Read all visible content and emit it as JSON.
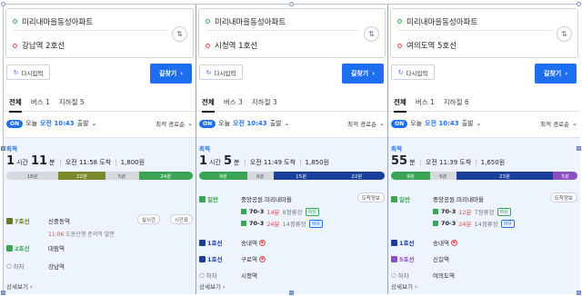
{
  "common": {
    "reset_label": "다시입력",
    "find_label": "길찾기",
    "today_label": "오늘",
    "on_label": "ON",
    "sort_label": "최적 경로순",
    "best_label": "최적",
    "more_label": "상세보기",
    "tab_all": "전체",
    "walk_label": "하차"
  },
  "panels": [
    {
      "start": "미리내마을동성아파트",
      "end": "강남역 2호선",
      "tabs": [
        "전체",
        "버스 1",
        "지하철 5"
      ],
      "depart_time": "오전 10:43",
      "depart_suffix": "출발",
      "duration_h": "1",
      "duration_h_unit": "시간",
      "duration_m": "11",
      "duration_m_unit": "분",
      "arrival": "오전 11:58 도착",
      "fare": "1,800원",
      "bar_segments": [
        {
          "label": "18분",
          "color": "#d6d9de",
          "dark": true
        },
        {
          "label": "22분",
          "color": "#7a8a2b",
          "dark": false
        },
        {
          "label": "5분",
          "color": "#d6d9de",
          "dark": true
        },
        {
          "label": "24분",
          "color": "#3aa655",
          "dark": false
        }
      ],
      "steps": [
        {
          "mode": "7호선",
          "color": "#6b7a1f",
          "place": "신중동역",
          "btn1": "실시간",
          "btn2": "시간표"
        },
        {
          "mode": "2호선",
          "color": "#3aa655",
          "place": "대림역"
        },
        {
          "mode": "하차",
          "color": "",
          "place": "강남역"
        }
      ],
      "sub_time": "11:06",
      "sub_text": "도봉산행",
      "sub_tail": "춘의역 발면"
    },
    {
      "start": "미리내마을동성아파트",
      "end": "시청역 1호선",
      "tabs": [
        "전체",
        "버스 3",
        "지하철 3"
      ],
      "depart_time": "오전 10:43",
      "depart_suffix": "출발",
      "duration_h": "1",
      "duration_h_unit": "시간",
      "duration_m": "5",
      "duration_m_unit": "분",
      "arrival": "오전 11:49 도착",
      "fare": "1,850원",
      "bar_segments": [
        {
          "label": "9분",
          "color": "#3aa655",
          "dark": false
        },
        {
          "label": "6분",
          "color": "#d6d9de",
          "dark": true
        },
        {
          "label": "15분",
          "color": "#1b3f9a",
          "dark": false
        },
        {
          "label": "22분",
          "color": "#1b3f9a",
          "dark": false
        }
      ],
      "stop_btn": "도착정보",
      "steps": [
        {
          "mode": "일반",
          "color": "#3aa655",
          "place": "중앙공원.미리내마을"
        },
        {
          "mode": "1호선",
          "color": "#1b3f9a",
          "place": "송내역"
        },
        {
          "mode": "1호선",
          "color": "#1b3f9a",
          "place": "구로역"
        },
        {
          "mode": "하차",
          "color": "",
          "place": "시청역"
        }
      ],
      "buses": [
        {
          "num": "70-3",
          "min": "14분",
          "info": "8정류장",
          "tag": "여유"
        },
        {
          "num": "70-3",
          "min": "24분",
          "info": "14정류장",
          "tag": "여유"
        }
      ]
    },
    {
      "start": "미리내마을동성아파트",
      "end": "여의도역 5호선",
      "tabs": [
        "전체",
        "버스 1",
        "지하철 6"
      ],
      "depart_time": "오전 10:43",
      "depart_suffix": "출발",
      "duration_h": "",
      "duration_h_unit": "",
      "duration_m": "55",
      "duration_m_unit": "분",
      "arrival": "오전 11:39 도착",
      "fare": "1,650원",
      "bar_segments": [
        {
          "label": "9분",
          "color": "#3aa655",
          "dark": false
        },
        {
          "label": "6분",
          "color": "#d6d9de",
          "dark": true
        },
        {
          "label": "23분",
          "color": "#1b3f9a",
          "dark": false
        },
        {
          "label": "5분",
          "color": "#8a4fc0",
          "dark": false
        }
      ],
      "stop_btn": "도착정보",
      "steps": [
        {
          "mode": "일반",
          "color": "#3aa655",
          "place": "중앙공원.미리내마을"
        },
        {
          "mode": "1호선",
          "color": "#1b3f9a",
          "place": "송내역"
        },
        {
          "mode": "5호선",
          "color": "#8a4fc0",
          "place": "신길역"
        },
        {
          "mode": "하차",
          "color": "",
          "place": "여의도역"
        }
      ],
      "buses": [
        {
          "num": "70-3",
          "min": "12분",
          "info": "7정류장",
          "tag": "여유"
        },
        {
          "num": "70-3",
          "min": "24분",
          "info": "14정류장",
          "tag": "여유"
        }
      ]
    }
  ]
}
